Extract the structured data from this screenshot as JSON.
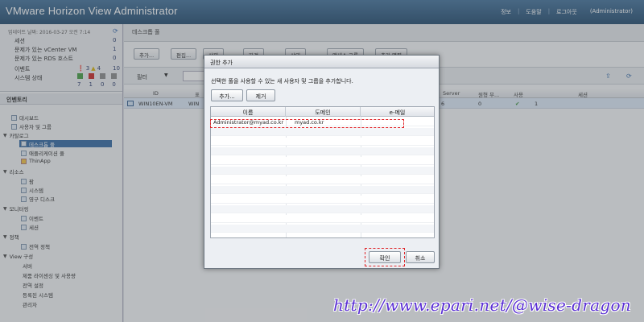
{
  "app": {
    "title": "VMware Horizon View Administrator"
  },
  "topnav": [
    "정보",
    "도움말",
    "로그아웃",
    "(Administrator)"
  ],
  "status": {
    "updated": "업데이트 날짜: 2016-03-27 오전 7:14",
    "rows": [
      {
        "label": "세션",
        "count": "0"
      },
      {
        "label": "문제가 있는 vCenter VM",
        "count": "1"
      },
      {
        "label": "문제가 있는 RDS 호스트",
        "count": "0"
      },
      {
        "label": "이벤트",
        "count": "10"
      },
      {
        "label": "시스템 상태",
        "count": ""
      }
    ],
    "event_counts": [
      "3",
      "4"
    ],
    "system_counts": [
      "7",
      "1",
      "0",
      "0"
    ]
  },
  "tree": {
    "title": "인벤토리",
    "items": [
      {
        "label": "대시보드"
      },
      {
        "label": "사용자 및 그룹"
      },
      {
        "label": "카탈로그"
      },
      {
        "label": "데스크톱 풀"
      },
      {
        "label": "애플리케이션 풀"
      },
      {
        "label": "ThinApp"
      },
      {
        "label": "리소스"
      },
      {
        "label": "팜"
      },
      {
        "label": "시스템"
      },
      {
        "label": "영구 디스크"
      },
      {
        "label": "모니터링"
      },
      {
        "label": "이벤트"
      },
      {
        "label": "세션"
      },
      {
        "label": "정책"
      },
      {
        "label": "전역 정책"
      },
      {
        "label": "View 구성"
      },
      {
        "label": "서버"
      },
      {
        "label": "제품 라이센싱 및 사용량"
      },
      {
        "label": "전역 설정"
      },
      {
        "label": "등록된 시스템"
      },
      {
        "label": "관리자"
      }
    ]
  },
  "content": {
    "breadcrumb": "데스크톱 풀",
    "toolbar": [
      "추가...",
      "편집...",
      "삭제",
      "자격",
      "상태",
      "액세스 그룹",
      "추가 명령"
    ],
    "filter": {
      "label": "필터",
      "arrow": "▼"
    },
    "headers": [
      "ID",
      "표",
      "Server",
      "원형 무...",
      "사용",
      "세션"
    ],
    "row": {
      "id": "WIN10EN-VM",
      "c2": "WIN",
      "c3": "6",
      "c4": "0",
      "c5": "✔",
      "c6": "1"
    }
  },
  "dialog": {
    "title": "권한 추가",
    "message": "선택한 풀을 사용할 수 있는 새 사용자 및 그룹을 추가합니다.",
    "add": "추가...",
    "remove": "제거",
    "headers": [
      "이름",
      "도메인",
      "e-메일"
    ],
    "entries": [
      {
        "name": "Administrator@myad.co.kr",
        "domain": "myad.co.kr",
        "email": ""
      }
    ],
    "ok": "확인",
    "cancel": "취소"
  },
  "watermark": "http://www.epari.net/@wise-dragon",
  "colors": {
    "accent": "#2e64a0",
    "highlight": "#e0262a",
    "watermark": "#5a2fd4"
  }
}
